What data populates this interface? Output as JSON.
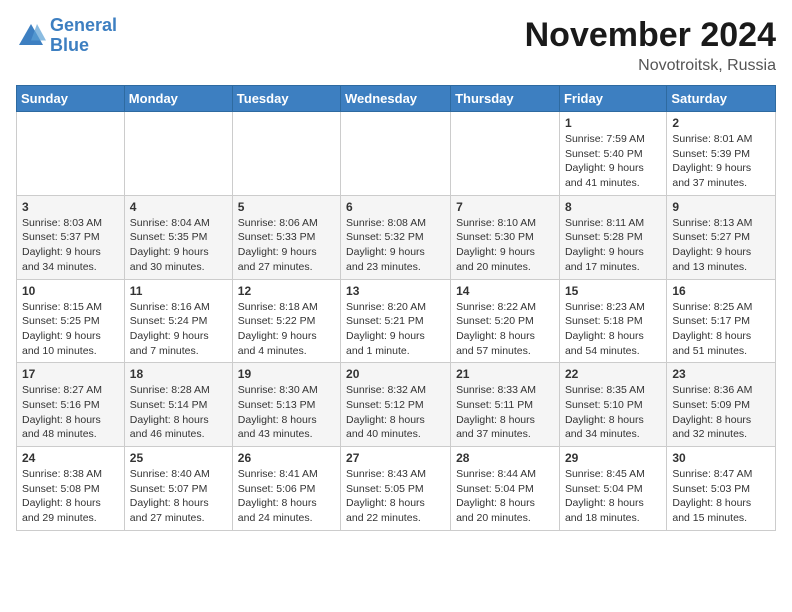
{
  "logo": {
    "line1": "General",
    "line2": "Blue"
  },
  "header": {
    "month": "November 2024",
    "location": "Novotroitsk, Russia"
  },
  "weekdays": [
    "Sunday",
    "Monday",
    "Tuesday",
    "Wednesday",
    "Thursday",
    "Friday",
    "Saturday"
  ],
  "weeks": [
    [
      {
        "day": "",
        "info": ""
      },
      {
        "day": "",
        "info": ""
      },
      {
        "day": "",
        "info": ""
      },
      {
        "day": "",
        "info": ""
      },
      {
        "day": "",
        "info": ""
      },
      {
        "day": "1",
        "info": "Sunrise: 7:59 AM\nSunset: 5:40 PM\nDaylight: 9 hours\nand 41 minutes."
      },
      {
        "day": "2",
        "info": "Sunrise: 8:01 AM\nSunset: 5:39 PM\nDaylight: 9 hours\nand 37 minutes."
      }
    ],
    [
      {
        "day": "3",
        "info": "Sunrise: 8:03 AM\nSunset: 5:37 PM\nDaylight: 9 hours\nand 34 minutes."
      },
      {
        "day": "4",
        "info": "Sunrise: 8:04 AM\nSunset: 5:35 PM\nDaylight: 9 hours\nand 30 minutes."
      },
      {
        "day": "5",
        "info": "Sunrise: 8:06 AM\nSunset: 5:33 PM\nDaylight: 9 hours\nand 27 minutes."
      },
      {
        "day": "6",
        "info": "Sunrise: 8:08 AM\nSunset: 5:32 PM\nDaylight: 9 hours\nand 23 minutes."
      },
      {
        "day": "7",
        "info": "Sunrise: 8:10 AM\nSunset: 5:30 PM\nDaylight: 9 hours\nand 20 minutes."
      },
      {
        "day": "8",
        "info": "Sunrise: 8:11 AM\nSunset: 5:28 PM\nDaylight: 9 hours\nand 17 minutes."
      },
      {
        "day": "9",
        "info": "Sunrise: 8:13 AM\nSunset: 5:27 PM\nDaylight: 9 hours\nand 13 minutes."
      }
    ],
    [
      {
        "day": "10",
        "info": "Sunrise: 8:15 AM\nSunset: 5:25 PM\nDaylight: 9 hours\nand 10 minutes."
      },
      {
        "day": "11",
        "info": "Sunrise: 8:16 AM\nSunset: 5:24 PM\nDaylight: 9 hours\nand 7 minutes."
      },
      {
        "day": "12",
        "info": "Sunrise: 8:18 AM\nSunset: 5:22 PM\nDaylight: 9 hours\nand 4 minutes."
      },
      {
        "day": "13",
        "info": "Sunrise: 8:20 AM\nSunset: 5:21 PM\nDaylight: 9 hours\nand 1 minute."
      },
      {
        "day": "14",
        "info": "Sunrise: 8:22 AM\nSunset: 5:20 PM\nDaylight: 8 hours\nand 57 minutes."
      },
      {
        "day": "15",
        "info": "Sunrise: 8:23 AM\nSunset: 5:18 PM\nDaylight: 8 hours\nand 54 minutes."
      },
      {
        "day": "16",
        "info": "Sunrise: 8:25 AM\nSunset: 5:17 PM\nDaylight: 8 hours\nand 51 minutes."
      }
    ],
    [
      {
        "day": "17",
        "info": "Sunrise: 8:27 AM\nSunset: 5:16 PM\nDaylight: 8 hours\nand 48 minutes."
      },
      {
        "day": "18",
        "info": "Sunrise: 8:28 AM\nSunset: 5:14 PM\nDaylight: 8 hours\nand 46 minutes."
      },
      {
        "day": "19",
        "info": "Sunrise: 8:30 AM\nSunset: 5:13 PM\nDaylight: 8 hours\nand 43 minutes."
      },
      {
        "day": "20",
        "info": "Sunrise: 8:32 AM\nSunset: 5:12 PM\nDaylight: 8 hours\nand 40 minutes."
      },
      {
        "day": "21",
        "info": "Sunrise: 8:33 AM\nSunset: 5:11 PM\nDaylight: 8 hours\nand 37 minutes."
      },
      {
        "day": "22",
        "info": "Sunrise: 8:35 AM\nSunset: 5:10 PM\nDaylight: 8 hours\nand 34 minutes."
      },
      {
        "day": "23",
        "info": "Sunrise: 8:36 AM\nSunset: 5:09 PM\nDaylight: 8 hours\nand 32 minutes."
      }
    ],
    [
      {
        "day": "24",
        "info": "Sunrise: 8:38 AM\nSunset: 5:08 PM\nDaylight: 8 hours\nand 29 minutes."
      },
      {
        "day": "25",
        "info": "Sunrise: 8:40 AM\nSunset: 5:07 PM\nDaylight: 8 hours\nand 27 minutes."
      },
      {
        "day": "26",
        "info": "Sunrise: 8:41 AM\nSunset: 5:06 PM\nDaylight: 8 hours\nand 24 minutes."
      },
      {
        "day": "27",
        "info": "Sunrise: 8:43 AM\nSunset: 5:05 PM\nDaylight: 8 hours\nand 22 minutes."
      },
      {
        "day": "28",
        "info": "Sunrise: 8:44 AM\nSunset: 5:04 PM\nDaylight: 8 hours\nand 20 minutes."
      },
      {
        "day": "29",
        "info": "Sunrise: 8:45 AM\nSunset: 5:04 PM\nDaylight: 8 hours\nand 18 minutes."
      },
      {
        "day": "30",
        "info": "Sunrise: 8:47 AM\nSunset: 5:03 PM\nDaylight: 8 hours\nand 15 minutes."
      }
    ]
  ]
}
